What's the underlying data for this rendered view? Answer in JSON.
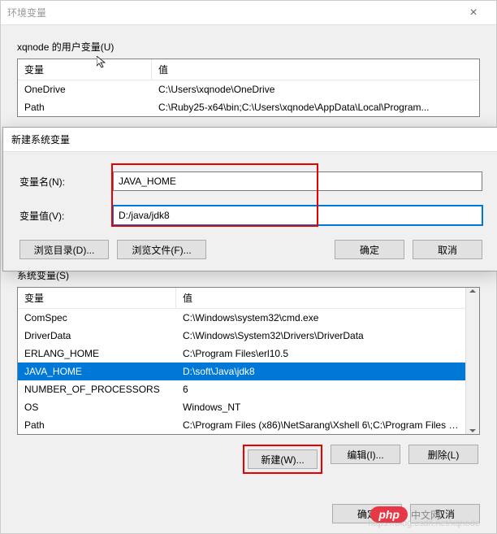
{
  "main": {
    "title": "环境变量",
    "userVarsLabel": "xqnode 的用户变量(U)",
    "sysVarsLabel": "系统变量(S)",
    "colName": "变量",
    "colValue": "值",
    "userVars": [
      {
        "name": "OneDrive",
        "value": "C:\\Users\\xqnode\\OneDrive"
      },
      {
        "name": "Path",
        "value": "C:\\Ruby25-x64\\bin;C:\\Users\\xqnode\\AppData\\Local\\Program..."
      }
    ],
    "sysVars": [
      {
        "name": "ComSpec",
        "value": "C:\\Windows\\system32\\cmd.exe"
      },
      {
        "name": "DriverData",
        "value": "C:\\Windows\\System32\\Drivers\\DriverData"
      },
      {
        "name": "ERLANG_HOME",
        "value": "C:\\Program Files\\erl10.5"
      },
      {
        "name": "JAVA_HOME",
        "value": "D:\\soft\\Java\\jdk8",
        "selected": true
      },
      {
        "name": "NUMBER_OF_PROCESSORS",
        "value": "6"
      },
      {
        "name": "OS",
        "value": "Windows_NT"
      },
      {
        "name": "Path",
        "value": "C:\\Program Files (x86)\\NetSarang\\Xshell 6\\;C:\\Program Files (..."
      }
    ],
    "btnNew": "新建(W)...",
    "btnEdit": "编辑(I)...",
    "btnDelete": "删除(L)",
    "btnOk": "确定",
    "btnCancel": "取消"
  },
  "modal": {
    "title": "新建系统变量",
    "nameLabel": "变量名(N):",
    "valueLabel": "变量值(V):",
    "nameInput": "JAVA_HOME",
    "valueInput": "D:/java/jdk8",
    "btnBrowseDir": "浏览目录(D)...",
    "btnBrowseFile": "浏览文件(F)...",
    "btnOk": "确定",
    "btnCancel": "取消"
  },
  "watermark": "https://blog.csdn.net/xqnode",
  "logo": {
    "badge": "php",
    "text": "中文网"
  }
}
